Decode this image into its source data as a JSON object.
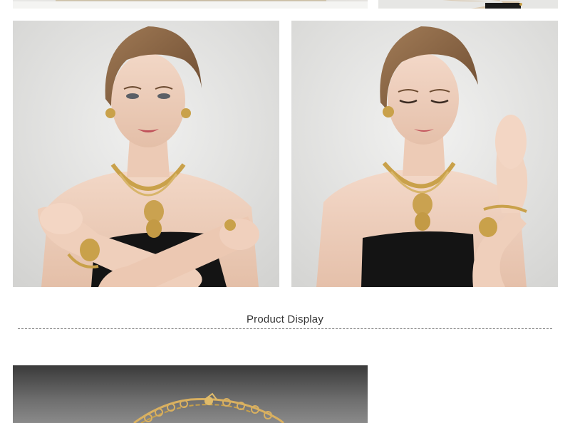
{
  "section": {
    "title": "Product Display"
  },
  "images": {
    "top_left": "jewelry-detail-photo",
    "top_right": "model-photo",
    "model_left": "model-arms-crossed-photo",
    "model_right": "model-hand-raised-photo",
    "bracelet": "bracelet-closeup-photo"
  },
  "colors": {
    "background": "#ffffff",
    "gold": "#c9a14a",
    "dress": "#121212",
    "backdrop": "#dedede"
  }
}
